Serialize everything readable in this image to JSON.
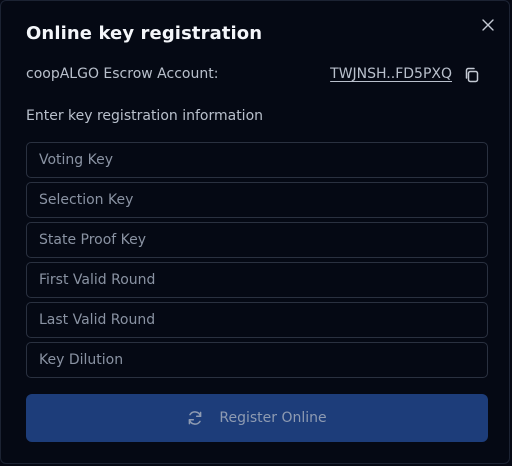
{
  "dialog": {
    "title": "Online key registration",
    "close_icon": "close-icon"
  },
  "account": {
    "label": "coopALGO Escrow Account:",
    "address": "TWJNSH..FD5PXQ",
    "copy_icon": "copy-icon"
  },
  "form": {
    "instructions": "Enter key registration information",
    "fields": [
      {
        "placeholder": "Voting Key",
        "value": ""
      },
      {
        "placeholder": "Selection Key",
        "value": ""
      },
      {
        "placeholder": "State Proof Key",
        "value": ""
      },
      {
        "placeholder": "First Valid Round",
        "value": ""
      },
      {
        "placeholder": "Last Valid Round",
        "value": ""
      },
      {
        "placeholder": "Key Dilution",
        "value": ""
      }
    ],
    "submit_label": "Register Online",
    "submit_icon": "refresh-icon"
  },
  "colors": {
    "background": "#050914",
    "border": "#2a3140",
    "button_bg": "#1d3d7a",
    "text": "#b9c0cc",
    "title": "#f4f6fa"
  }
}
